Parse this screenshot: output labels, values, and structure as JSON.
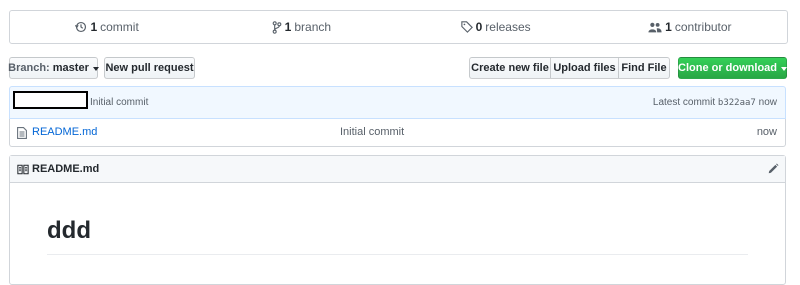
{
  "summary": {
    "commits": {
      "count": "1",
      "label": "commit",
      "icon": "history-icon"
    },
    "branches": {
      "count": "1",
      "label": "branch",
      "icon": "branch-icon"
    },
    "releases": {
      "count": "0",
      "label": "releases",
      "icon": "tag-icon"
    },
    "contributors": {
      "count": "1",
      "label": "contributor",
      "icon": "people-icon"
    }
  },
  "nav": {
    "branch_prefix": "Branch:",
    "branch_name": "master",
    "new_pull_request": "New pull request",
    "create_new_file": "Create new file",
    "upload_files": "Upload files",
    "find_file": "Find File",
    "clone_or_download": "Clone or download"
  },
  "commit_tease": {
    "message": "Initial commit",
    "latest_label": "Latest commit",
    "sha": "b322aa7",
    "age": "now"
  },
  "files": [
    {
      "name": "README.md",
      "message": "Initial commit",
      "age": "now",
      "icon": "file-icon"
    }
  ],
  "readme": {
    "title": "README.md",
    "heading": "ddd"
  },
  "colors": {
    "link": "#0366d6",
    "clone_button": "#28a745",
    "commit_tease_bg": "#f1f8ff",
    "border": "#d1d5da"
  }
}
